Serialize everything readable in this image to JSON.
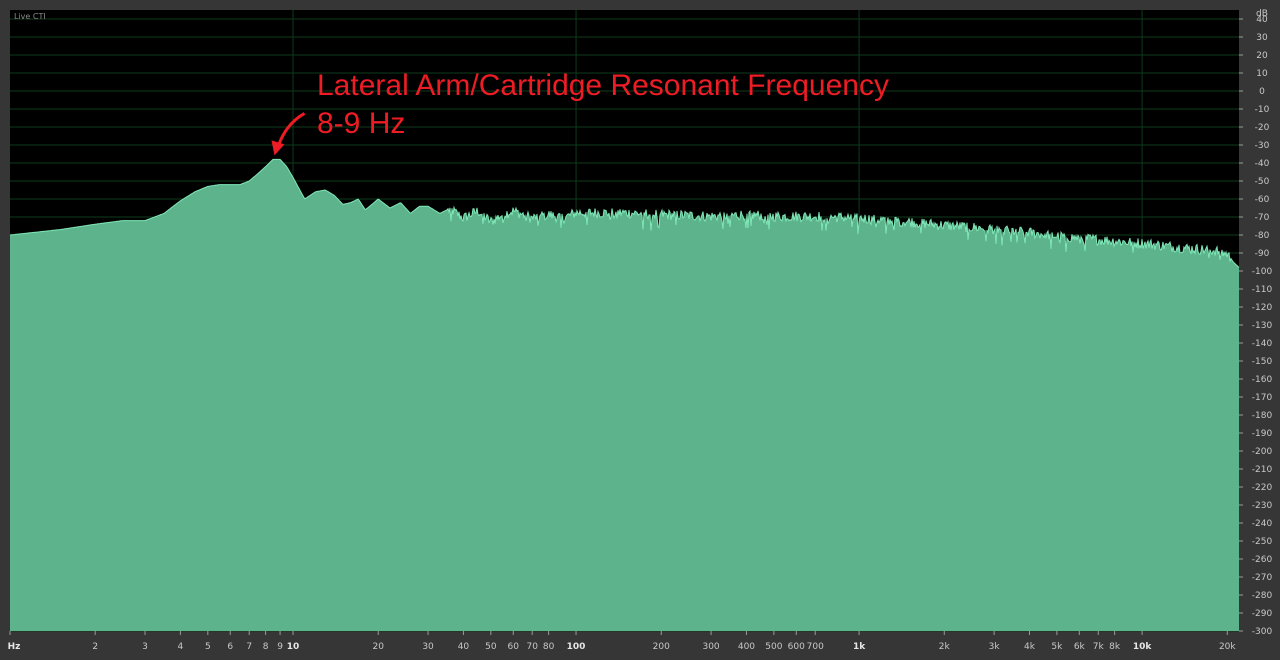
{
  "header": {
    "live_label": "Live CTI"
  },
  "annotation": {
    "line1": "Lateral Arm/Cartridge Resonant Frequency",
    "line2": "8-9 Hz",
    "target_hz": 8.6,
    "color": "#ee1c24"
  },
  "colors": {
    "background": "#000000",
    "fill": "#5db48c",
    "edge": "#7fe8b8",
    "grid": "#0e3a1c",
    "panel": "#363636"
  },
  "chart_data": {
    "type": "area",
    "title": "",
    "xlabel": "Hz",
    "ylabel": "dB",
    "x_scale": "log",
    "xlim": [
      1,
      22000
    ],
    "ylim": [
      -300,
      45
    ],
    "grid": true,
    "x_ticks": [
      {
        "v": 1,
        "label": "Hz",
        "bold": true
      },
      {
        "v": 2,
        "label": "2"
      },
      {
        "v": 3,
        "label": "3"
      },
      {
        "v": 4,
        "label": "4"
      },
      {
        "v": 5,
        "label": "5"
      },
      {
        "v": 6,
        "label": "6"
      },
      {
        "v": 7,
        "label": "7"
      },
      {
        "v": 8,
        "label": "8"
      },
      {
        "v": 9,
        "label": "9"
      },
      {
        "v": 10,
        "label": "10",
        "bold": true
      },
      {
        "v": 20,
        "label": "20"
      },
      {
        "v": 30,
        "label": "30"
      },
      {
        "v": 40,
        "label": "40"
      },
      {
        "v": 50,
        "label": "50"
      },
      {
        "v": 60,
        "label": "60"
      },
      {
        "v": 70,
        "label": "70"
      },
      {
        "v": 80,
        "label": "80"
      },
      {
        "v": 100,
        "label": "100",
        "bold": true
      },
      {
        "v": 200,
        "label": "200"
      },
      {
        "v": 300,
        "label": "300"
      },
      {
        "v": 400,
        "label": "400"
      },
      {
        "v": 500,
        "label": "500"
      },
      {
        "v": 600,
        "label": "600"
      },
      {
        "v": 700,
        "label": "700"
      },
      {
        "v": 1000,
        "label": "1k",
        "bold": true
      },
      {
        "v": 2000,
        "label": "2k"
      },
      {
        "v": 3000,
        "label": "3k"
      },
      {
        "v": 4000,
        "label": "4k"
      },
      {
        "v": 5000,
        "label": "5k"
      },
      {
        "v": 6000,
        "label": "6k"
      },
      {
        "v": 7000,
        "label": "7k"
      },
      {
        "v": 8000,
        "label": "8k"
      },
      {
        "v": 10000,
        "label": "10k",
        "bold": true
      },
      {
        "v": 20000,
        "label": "20k"
      }
    ],
    "y_ticks": [
      {
        "v": 40,
        "label": "40"
      },
      {
        "v": 30,
        "label": "30"
      },
      {
        "v": 20,
        "label": "20"
      },
      {
        "v": 10,
        "label": "10"
      },
      {
        "v": 0,
        "label": "0"
      },
      {
        "v": -10,
        "label": "-10"
      },
      {
        "v": -20,
        "label": "-20"
      },
      {
        "v": -30,
        "label": "-30"
      },
      {
        "v": -40,
        "label": "-40"
      },
      {
        "v": -50,
        "label": "-50"
      },
      {
        "v": -60,
        "label": "-60"
      },
      {
        "v": -70,
        "label": "-70"
      },
      {
        "v": -80,
        "label": "-80"
      },
      {
        "v": -90,
        "label": "-90"
      },
      {
        "v": -100,
        "label": "-100"
      },
      {
        "v": -110,
        "label": "-110"
      },
      {
        "v": -120,
        "label": "-120"
      },
      {
        "v": -130,
        "label": "-130"
      },
      {
        "v": -140,
        "label": "-140"
      },
      {
        "v": -150,
        "label": "-150"
      },
      {
        "v": -160,
        "label": "-160"
      },
      {
        "v": -170,
        "label": "-170"
      },
      {
        "v": -180,
        "label": "-180"
      },
      {
        "v": -190,
        "label": "-190"
      },
      {
        "v": -200,
        "label": "-200"
      },
      {
        "v": -210,
        "label": "-210"
      },
      {
        "v": -220,
        "label": "-220"
      },
      {
        "v": -230,
        "label": "-230"
      },
      {
        "v": -240,
        "label": "-240"
      },
      {
        "v": -250,
        "label": "-250"
      },
      {
        "v": -260,
        "label": "-260"
      },
      {
        "v": -270,
        "label": "-270"
      },
      {
        "v": -280,
        "label": "-280"
      },
      {
        "v": -290,
        "label": "-290"
      },
      {
        "v": -300,
        "label": "-300"
      }
    ],
    "series": [
      {
        "x": [
          1,
          1.5,
          2,
          2.5,
          3,
          3.5,
          4,
          4.5,
          5,
          5.5,
          6,
          6.5,
          7,
          7.5,
          8,
          8.5,
          9,
          9.5,
          10,
          11,
          12,
          13,
          14,
          15,
          16,
          17,
          18,
          19,
          20,
          22,
          24,
          26,
          28,
          30,
          33,
          36,
          40,
          45,
          50,
          55,
          60,
          70,
          80,
          90,
          100,
          150,
          200,
          300,
          400,
          500,
          700,
          1000,
          1500,
          2000,
          3000,
          4000,
          5000,
          7000,
          10000,
          15000,
          18000,
          20000,
          21000,
          22000
        ],
        "y": [
          -80,
          -77,
          -74,
          -72,
          -72,
          -68,
          -61,
          -56,
          -53,
          -52,
          -52,
          -52,
          -50,
          -46,
          -42,
          -38,
          -38,
          -42,
          -48,
          -60,
          -56,
          -55,
          -58,
          -63,
          -62,
          -60,
          -66,
          -63,
          -60,
          -65,
          -62,
          -68,
          -64,
          -64,
          -68,
          -65,
          -70,
          -66,
          -72,
          -68,
          -66,
          -70,
          -68,
          -70,
          -67,
          -67,
          -68,
          -69,
          -68,
          -69,
          -69,
          -70,
          -72,
          -74,
          -76,
          -78,
          -80,
          -82,
          -84,
          -87,
          -88,
          -90,
          -95,
          -98
        ]
      }
    ]
  }
}
